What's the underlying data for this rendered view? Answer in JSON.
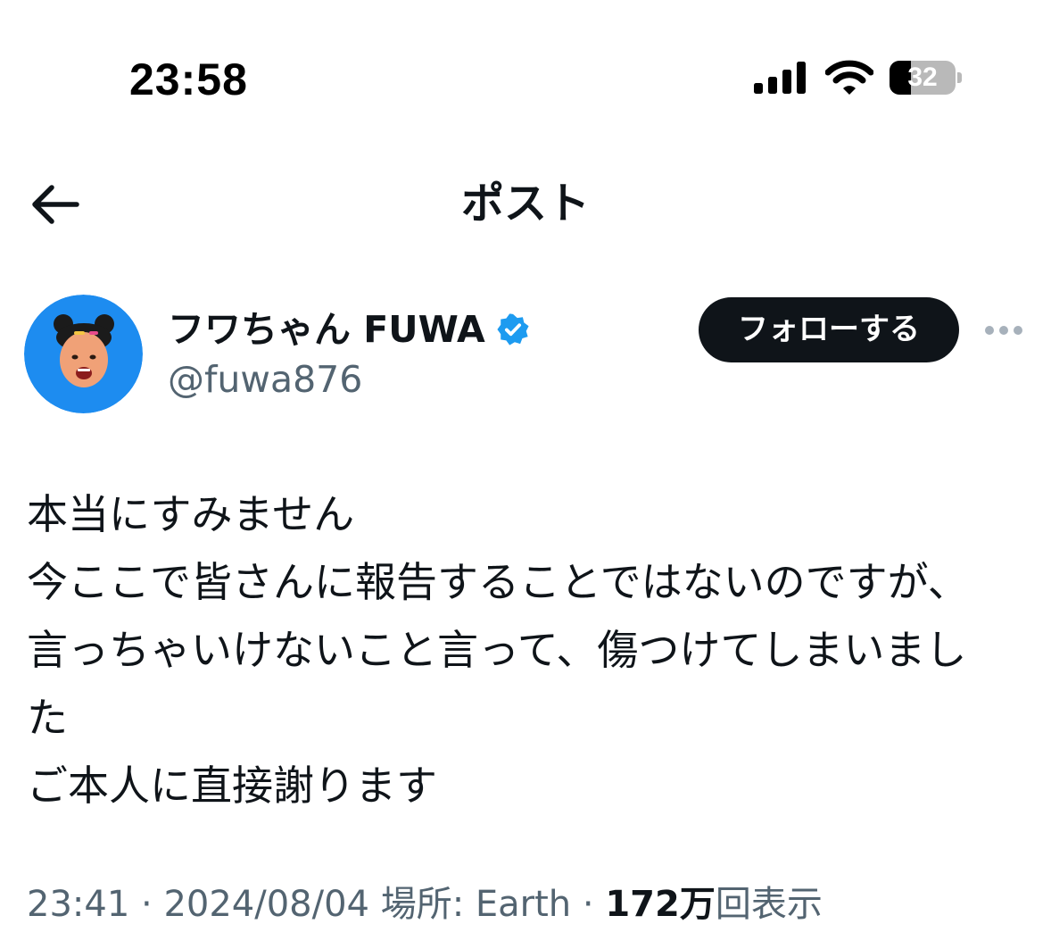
{
  "status_bar": {
    "time": "23:58",
    "battery_level": "32",
    "battery_fraction": 0.32,
    "icons": [
      "cellular-signal-icon",
      "wifi-icon",
      "battery-icon"
    ]
  },
  "header": {
    "title": "ポスト",
    "back_icon": "arrow-left-icon"
  },
  "author": {
    "display_name": "フワちゃん FUWA",
    "handle": "@fuwa876",
    "verified": true,
    "avatar_background": "#1d8cf0"
  },
  "actions": {
    "follow_label": "フォローする",
    "more_icon": "more-dots-icon"
  },
  "post": {
    "lines": [
      "本当にすみません",
      "今ここで皆さんに報告することではないのですが、",
      "言っちゃいけないこと言って、傷つけてしまいまし",
      "た",
      "ご本人に直接謝ります"
    ]
  },
  "meta": {
    "time": "23:41",
    "separator": "·",
    "date": "2024/08/04",
    "location": "場所: Earth",
    "views_count": "172万",
    "views_label": "回表示"
  },
  "colors": {
    "text_primary": "#0f1419",
    "text_secondary": "#536471",
    "verified_blue": "#1d9bf0",
    "follow_button_bg": "#0f1419"
  }
}
